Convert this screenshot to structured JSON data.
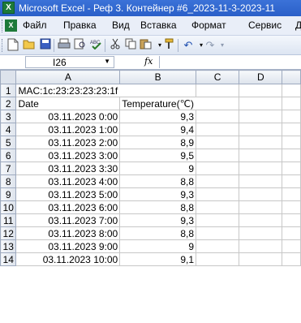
{
  "window": {
    "title": "Microsoft Excel - Реф 3. Контейнер #6_2023-11-3-2023-11"
  },
  "menu": [
    "Файл",
    "Правка",
    "Вид",
    "Вставка",
    "Формат",
    "Сервис",
    "Д"
  ],
  "toolbar": {
    "icons": [
      "new-icon",
      "open-icon",
      "save-icon",
      "print-icon",
      "print-preview-icon",
      "spelling-icon",
      "cut-icon",
      "copy-icon",
      "paste-icon",
      "format-painter-icon",
      "undo-icon",
      "redo-icon"
    ]
  },
  "formula_bar": {
    "cell_ref": "I26",
    "fx": "fx",
    "formula": ""
  },
  "columns": [
    "A",
    "B",
    "C",
    "D"
  ],
  "rows": [
    {
      "n": "1",
      "a": "MAC:1c:23:23:23:23:1f",
      "b": ""
    },
    {
      "n": "2",
      "a": "Date",
      "b": "Temperature(℃)"
    },
    {
      "n": "3",
      "a": "03.11.2023 0:00",
      "b": "9,3"
    },
    {
      "n": "4",
      "a": "03.11.2023 1:00",
      "b": "9,4"
    },
    {
      "n": "5",
      "a": "03.11.2023 2:00",
      "b": "8,9"
    },
    {
      "n": "6",
      "a": "03.11.2023 3:00",
      "b": "9,5"
    },
    {
      "n": "7",
      "a": "03.11.2023 3:30",
      "b": "9"
    },
    {
      "n": "8",
      "a": "03.11.2023 4:00",
      "b": "8,8"
    },
    {
      "n": "9",
      "a": "03.11.2023 5:00",
      "b": "9,3"
    },
    {
      "n": "10",
      "a": "03.11.2023 6:00",
      "b": "8,8"
    },
    {
      "n": "11",
      "a": "03.11.2023 7:00",
      "b": "9,3"
    },
    {
      "n": "12",
      "a": "03.11.2023 8:00",
      "b": "8,8"
    },
    {
      "n": "13",
      "a": "03.11.2023 9:00",
      "b": "9"
    },
    {
      "n": "14",
      "a": "03.11.2023 10:00",
      "b": "9,1"
    }
  ]
}
